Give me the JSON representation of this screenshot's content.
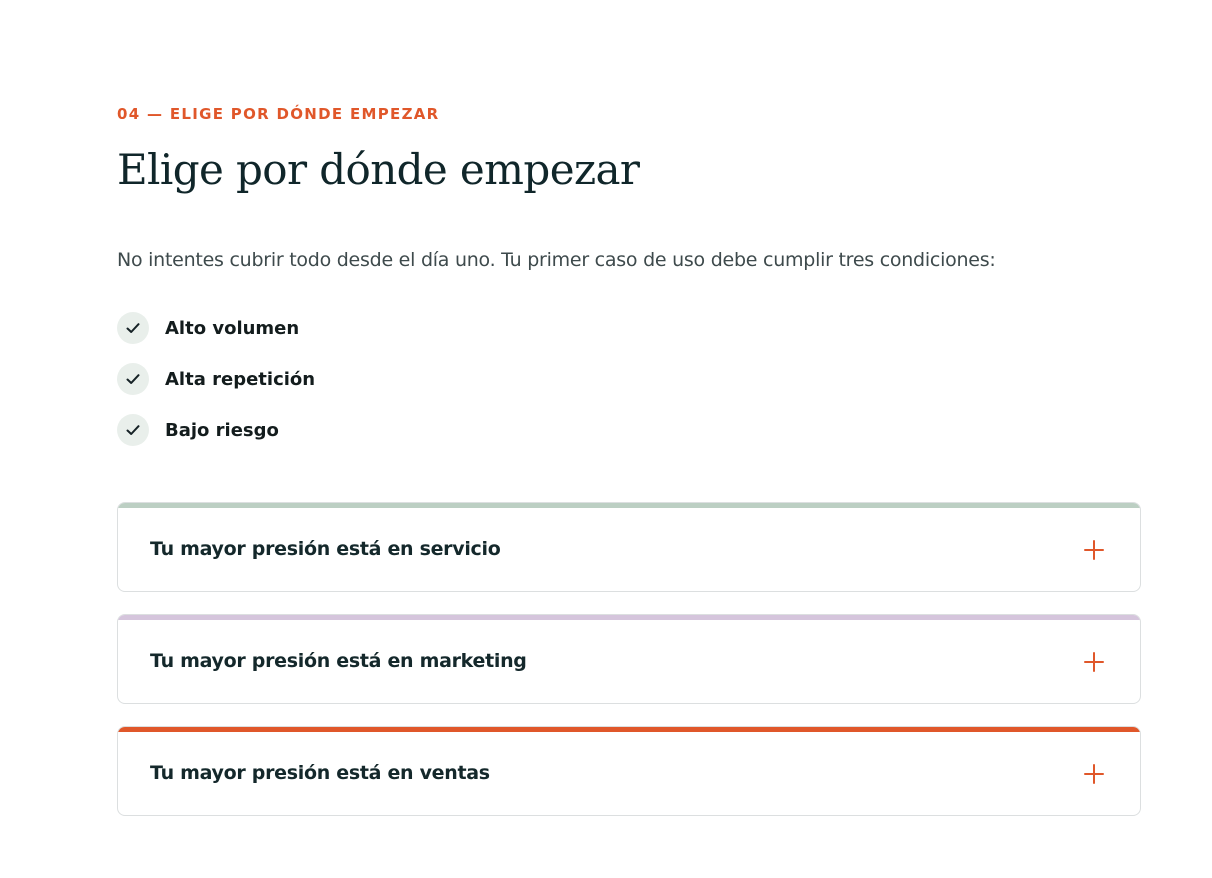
{
  "section": {
    "eyebrow": "04 — ELIGE POR DÓNDE EMPEZAR",
    "title": "Elige por dónde empezar",
    "intro": "No intentes cubrir todo desde el día uno. Tu primer caso de uso debe cumplir tres condiciones:"
  },
  "checklist": {
    "icon": "checkmark-icon",
    "items": [
      {
        "label": "Alto volumen"
      },
      {
        "label": "Alta repetición"
      },
      {
        "label": "Bajo riesgo"
      }
    ]
  },
  "accordion": {
    "expand_icon": "plus-icon",
    "items": [
      {
        "title": "Tu mayor presión está en servicio",
        "accent": "#bccfc3"
      },
      {
        "title": "Tu mayor presión está en marketing",
        "accent": "#d5c5dc"
      },
      {
        "title": "Tu mayor presión está en ventas",
        "accent": "#e0572a"
      }
    ]
  },
  "colors": {
    "accent": "#e0572a",
    "heading": "#10262a",
    "body_text": "#3e4a4c",
    "check_bg": "#e9efeb",
    "card_border": "#dcdfe0"
  }
}
